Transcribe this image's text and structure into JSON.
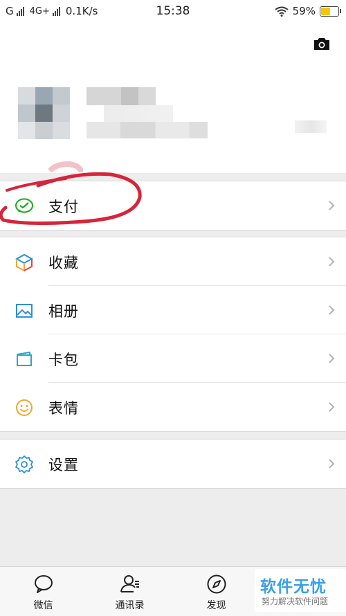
{
  "status_bar": {
    "carrier1": "G",
    "carrier2": "4G+",
    "speed": "0.1K/s",
    "time": "15:38",
    "battery_text": "59%",
    "battery_level": 0.59,
    "battery_color": "#f6c700"
  },
  "header": {
    "camera_icon": "camera-icon"
  },
  "menu": {
    "pay": {
      "label": "支付",
      "icon": "wechat-pay-icon",
      "color": "#1aad19"
    },
    "items": [
      {
        "label": "收藏",
        "icon": "favorites-cube-icon"
      },
      {
        "label": "相册",
        "icon": "album-icon",
        "color": "#2b90d9"
      },
      {
        "label": "卡包",
        "icon": "card-wallet-icon",
        "color": "#2aa7c9"
      },
      {
        "label": "表情",
        "icon": "emoji-smile-icon",
        "color": "#f0a830"
      }
    ],
    "settings": {
      "label": "设置",
      "icon": "gear-icon",
      "color": "#2b90d9"
    }
  },
  "tabs": [
    {
      "label": "微信",
      "icon": "chat-bubble-icon"
    },
    {
      "label": "通讯录",
      "icon": "contacts-icon"
    },
    {
      "label": "发现",
      "icon": "compass-icon"
    }
  ],
  "watermark": {
    "title": "软件无忧",
    "subtitle": "努力解决软件问题"
  },
  "annotation_color": "#d6253a"
}
